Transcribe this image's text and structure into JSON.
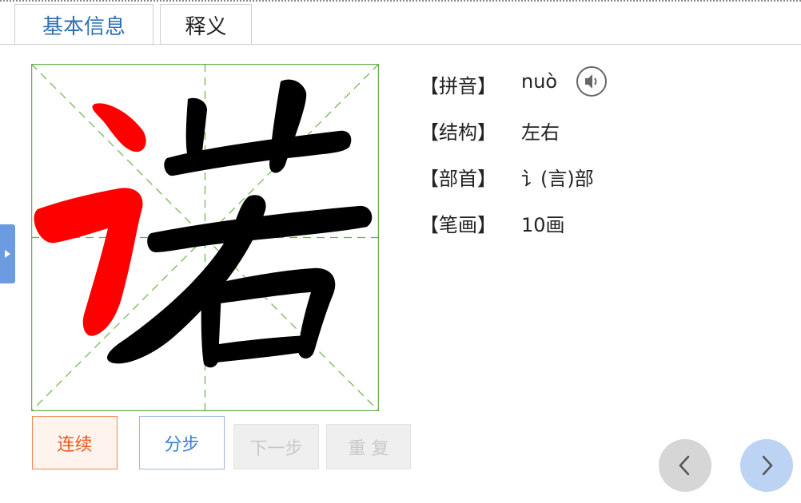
{
  "tabs": [
    {
      "label": "基本信息",
      "active": true
    },
    {
      "label": "释义",
      "active": false
    }
  ],
  "character": {
    "glyph": "诺",
    "highlight_color": "#ff0000",
    "stroke_color": "#000000",
    "grid_color": "#6ab04c"
  },
  "info": {
    "pinyin": {
      "label": "【拼音】",
      "value": "nuò"
    },
    "structure": {
      "label": "【结构】",
      "value": "左右"
    },
    "radical": {
      "label": "【部首】",
      "value": "讠(言)部"
    },
    "strokes": {
      "label": "【笔画】",
      "value": "10画"
    }
  },
  "icons": {
    "speaker": "speaker-icon",
    "side_toggle": "triangle-right-icon",
    "prev": "chevron-left-icon",
    "next": "chevron-right-icon"
  },
  "controls": {
    "continuous": "连续",
    "step": "分步",
    "next_step": "下一步",
    "repeat": "重 复"
  }
}
